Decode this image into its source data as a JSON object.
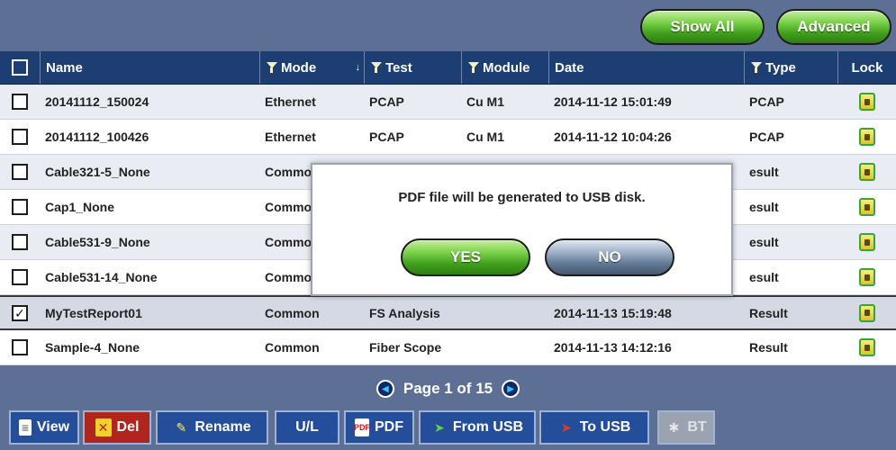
{
  "toolbar_top": {
    "show_all": "Show All",
    "advanced": "Advanced"
  },
  "columns": {
    "name": "Name",
    "mode": "Mode",
    "test": "Test",
    "module": "Module",
    "date": "Date",
    "type": "Type",
    "lock": "Lock",
    "sort_indicator": "↓"
  },
  "rows": [
    {
      "checked": false,
      "name": "20141112_150024",
      "mode": "Ethernet",
      "test": "PCAP",
      "module": "Cu M1",
      "date": "2014-11-12 15:01:49",
      "type": "PCAP",
      "lock_icon": "lock-icon"
    },
    {
      "checked": false,
      "name": "20141112_100426",
      "mode": "Ethernet",
      "test": "PCAP",
      "module": "Cu M1",
      "date": "2014-11-12 10:04:26",
      "type": "PCAP",
      "lock_icon": "lock-icon"
    },
    {
      "checked": false,
      "name": "Cable321-5_None",
      "mode": "Commo",
      "test": "",
      "module": "",
      "date": "",
      "type": "esult",
      "lock_icon": "lock-icon"
    },
    {
      "checked": false,
      "name": "Cap1_None",
      "mode": "Commo",
      "test": "",
      "module": "",
      "date": "",
      "type": "esult",
      "lock_icon": "lock-icon"
    },
    {
      "checked": false,
      "name": "Cable531-9_None",
      "mode": "Commo",
      "test": "",
      "module": "",
      "date": "",
      "type": "esult",
      "lock_icon": "lock-icon"
    },
    {
      "checked": false,
      "name": "Cable531-14_None",
      "mode": "Commo",
      "test": "",
      "module": "",
      "date": "",
      "type": "esult",
      "lock_icon": "lock-icon"
    },
    {
      "checked": true,
      "name": "MyTestReport01",
      "mode": "Common",
      "test": "FS Analysis",
      "module": "",
      "date": "2014-11-13 15:19:48",
      "type": "Result",
      "lock_icon": "lock-icon"
    },
    {
      "checked": false,
      "name": "Sample-4_None",
      "mode": "Common",
      "test": "Fiber Scope",
      "module": "",
      "date": "2014-11-13 14:12:16",
      "type": "Result",
      "lock_icon": "lock-icon"
    }
  ],
  "pager": {
    "label": "Page 1 of 15"
  },
  "bottom_toolbar": {
    "view": "View",
    "del": "Del",
    "rename": "Rename",
    "ul": "U/L",
    "pdf": "PDF",
    "from_usb": "From USB",
    "to_usb": "To USB",
    "bt": "BT"
  },
  "dialog": {
    "message": "PDF file will be generated to USB disk.",
    "yes": "YES",
    "no": "NO"
  },
  "colors": {
    "bar_bg": "#5d6f95",
    "header_bg": "#1d3e73",
    "green_button": "#3f9e1c",
    "grey_button": "#5f7792",
    "del_red": "#b0251e"
  }
}
